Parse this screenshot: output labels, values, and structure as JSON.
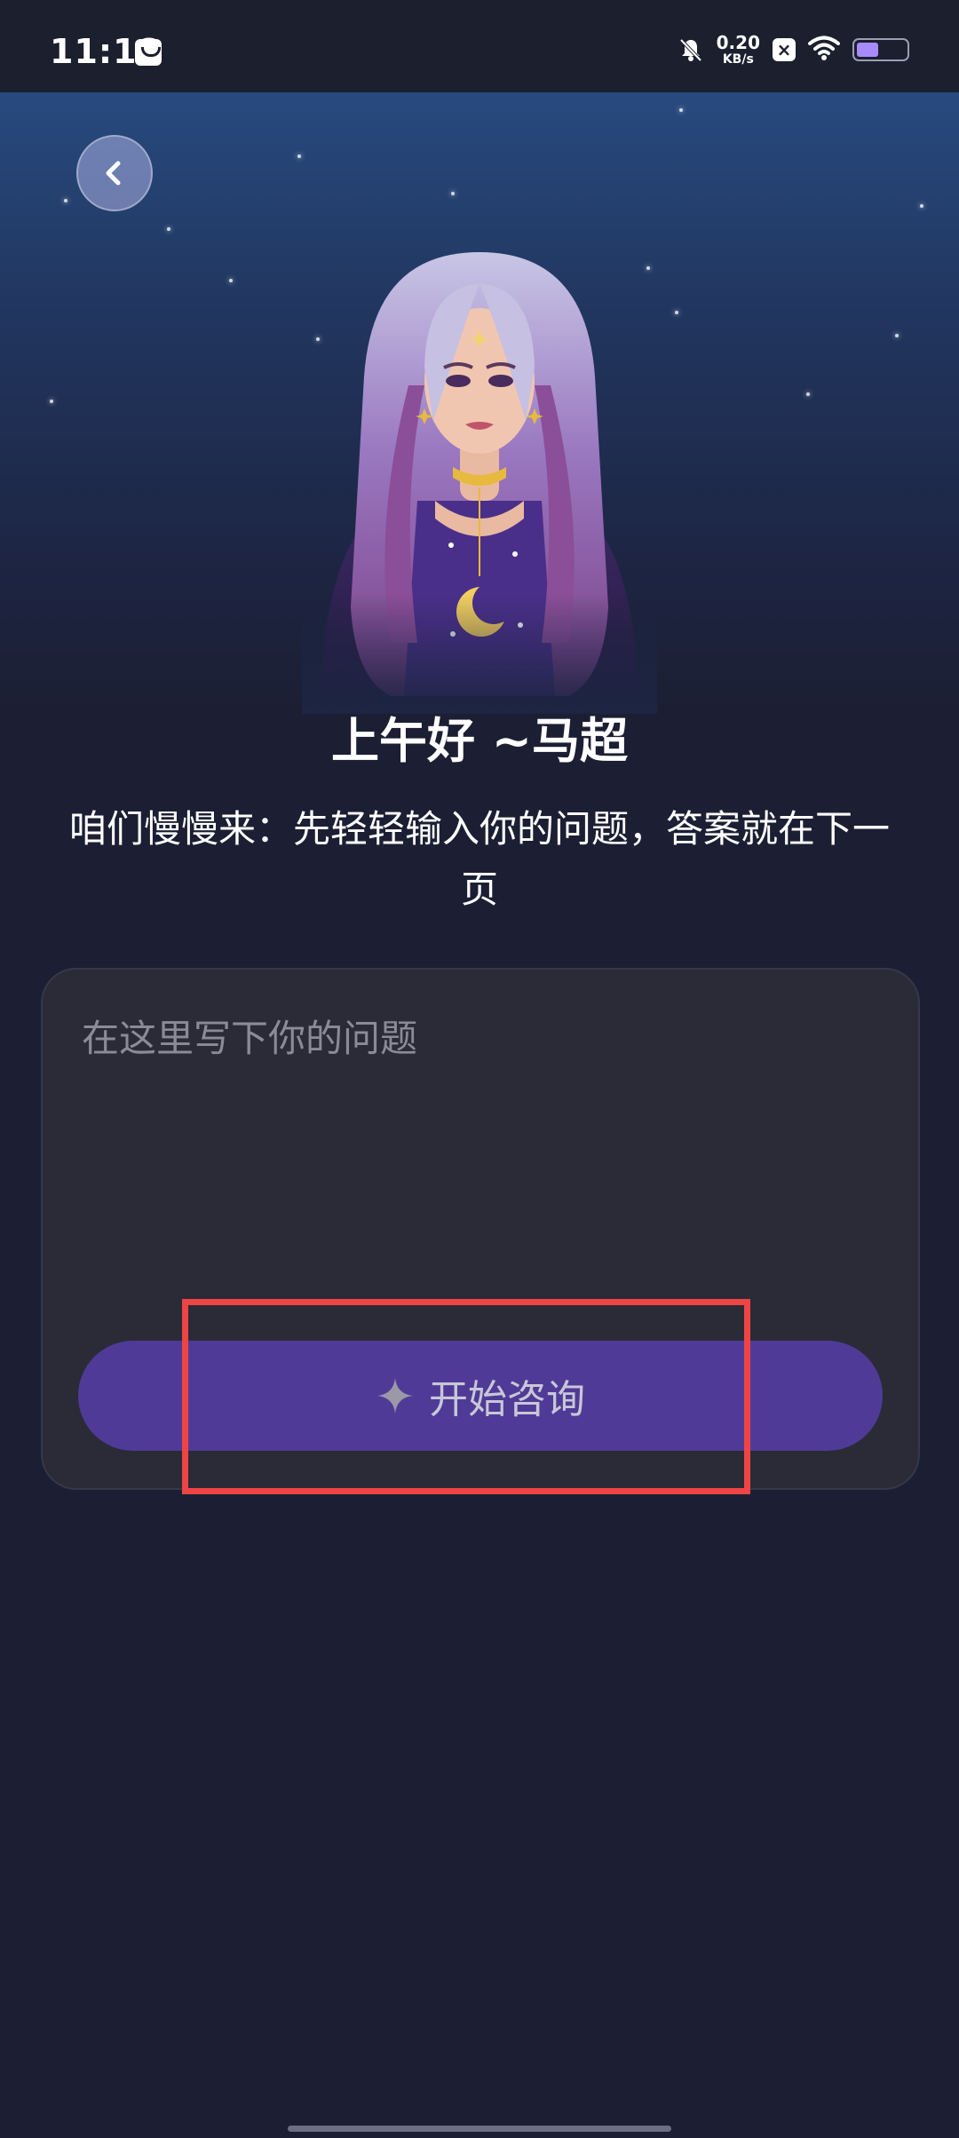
{
  "status_bar": {
    "time": "11:18",
    "net_speed_value": "0.20",
    "net_speed_unit": "KB/s",
    "battery_level": 0.45,
    "icons": [
      "message-icon",
      "mute-icon",
      "close-box-icon",
      "wifi-icon",
      "battery-icon"
    ]
  },
  "header": {
    "back_icon": "chevron-left-icon"
  },
  "main": {
    "greeting": "上午好 ~马超",
    "subtitle": "咱们慢慢来：先轻轻输入你的问题，答案就在下一页",
    "question_placeholder": "在这里写下你的问题",
    "question_value": "",
    "consult_button_label": "开始咨询",
    "consult_button_icon": "sparkle-icon"
  },
  "colors": {
    "accent": "#4f3b97",
    "highlight": "#ef4444",
    "card": "#2a2b37",
    "background": "#1c1f33"
  }
}
